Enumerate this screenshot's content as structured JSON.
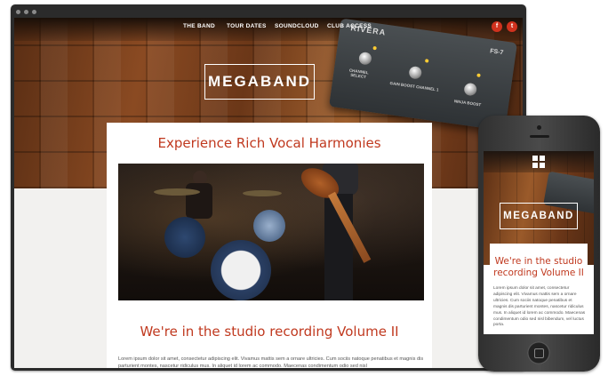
{
  "site": {
    "nav": [
      "THE BAND",
      "TOUR DATES",
      "SOUNDCLOUD",
      "CLUB ACCESS"
    ],
    "social": [
      {
        "icon": "facebook-icon",
        "glyph": "f"
      },
      {
        "icon": "twitter-icon",
        "glyph": "t"
      }
    ],
    "logo": "MEGABAND",
    "pedal": {
      "brand": "RIVERA",
      "model": "FS-7",
      "labels": [
        "CHANNEL SELECT",
        "GAIN BOOST CHANNEL 1",
        "NINJA BOOST"
      ]
    },
    "headline": "Experience Rich Vocal Harmonies",
    "subheadline": "We're in the studio recording Volume II",
    "body": "Lorem ipsum dolor sit amet, consectetur adipiscing elit. Vivamus mattis sem a ornare ultricies. Cum sociis natoque penatibus et magnis dis parturient montes, nascetur ridiculus mus. In aliquet id lorem ac commodo. Maecenas condimentum odio sed nisl"
  },
  "mobile": {
    "logo": "MEGABAND",
    "headline": "We're in the studio recording Volume II",
    "body": "Lorem ipsum dolor sit amet, consectetur adipiscing elit. Vivamus mattis sem a ornare ultricies. Cum sociis natoque penatibus et magnis dis parturient montes, nascetur ridiculus mus. In aliquet id lorem ac commodo. Maecenas condimentum odio sed nisl bibendum, vel luctus porta."
  },
  "colors": {
    "accent": "#c0391f",
    "social": "#d0321e",
    "device": "#2b2b2b"
  }
}
